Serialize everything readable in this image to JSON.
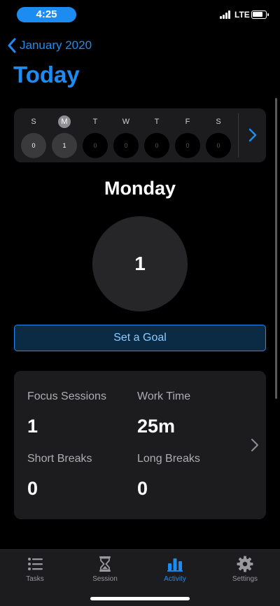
{
  "status": {
    "time": "4:25",
    "network": "LTE"
  },
  "nav": {
    "back_label": "January 2020",
    "title": "Today"
  },
  "week": {
    "days": [
      {
        "letter": "S",
        "count": "0",
        "selected": false,
        "active": true
      },
      {
        "letter": "M",
        "count": "1",
        "selected": true,
        "active": true
      },
      {
        "letter": "T",
        "count": "0",
        "selected": false,
        "active": false
      },
      {
        "letter": "W",
        "count": "0",
        "selected": false,
        "active": false
      },
      {
        "letter": "T",
        "count": "0",
        "selected": false,
        "active": false
      },
      {
        "letter": "F",
        "count": "0",
        "selected": false,
        "active": false
      },
      {
        "letter": "S",
        "count": "0",
        "selected": false,
        "active": false
      }
    ]
  },
  "day": {
    "name": "Monday",
    "count": "1"
  },
  "goal": {
    "label": "Set a Goal"
  },
  "stats": {
    "focus_sessions": {
      "label": "Focus Sessions",
      "value": "1"
    },
    "work_time": {
      "label": "Work Time",
      "value": "25m"
    },
    "short_breaks": {
      "label": "Short Breaks",
      "value": "0"
    },
    "long_breaks": {
      "label": "Long Breaks",
      "value": "0"
    }
  },
  "tabs": [
    {
      "label": "Tasks",
      "icon": "list-icon",
      "active": false
    },
    {
      "label": "Session",
      "icon": "hourglass-icon",
      "active": false
    },
    {
      "label": "Activity",
      "icon": "bar-chart-icon",
      "active": true
    },
    {
      "label": "Settings",
      "icon": "gear-icon",
      "active": false
    }
  ],
  "colors": {
    "accent": "#1d8cf2",
    "background": "#000000",
    "card": "#1c1c1e"
  }
}
